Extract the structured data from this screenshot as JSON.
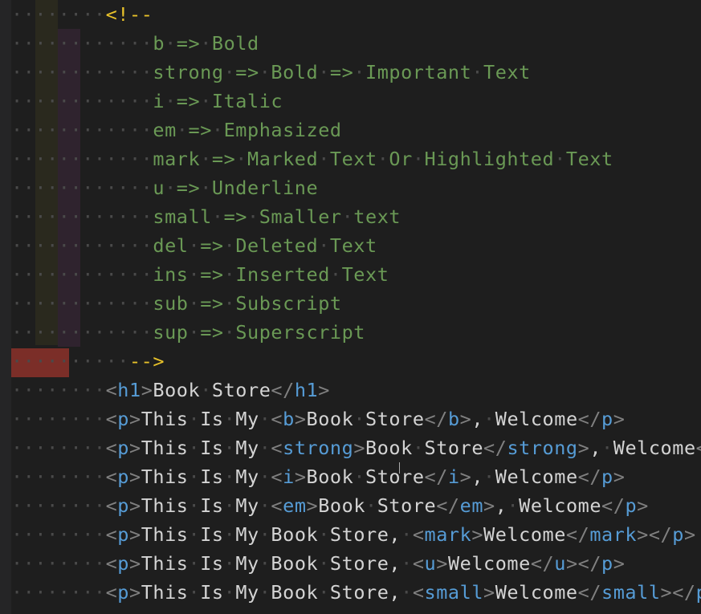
{
  "editor": {
    "comment_open": "<!--",
    "comment_close": "-->",
    "comment_lines": [
      "b => Bold",
      "strong => Bold => Important Text",
      "i => Italic",
      "em => Emphasized",
      "mark => Marked Text Or Highlighted Text",
      "u => Underline",
      "small => Smaller text",
      "del => Deleted Text",
      "ins => Inserted Text",
      "sub => Subscript",
      "sup => Superscript"
    ],
    "code_lines": [
      "<h1>Book Store</h1>",
      "<p>This Is My <b>Book Store</b>, Welcome</p>",
      "<p>This Is My <strong>Book Store</strong>, Welcome</p>",
      "<p>This Is My <i>Book Store</i>, Welcome</p>",
      "<p>This Is My <em>Book Store</em>, Welcome</p>",
      "<p>This Is My Book Store, <mark>Welcome</mark></p>",
      "<p>This Is My Book Store, <u>Welcome</u></p>",
      "<p>This Is My Book Store, <small>Welcome</small></p>"
    ]
  },
  "colors": {
    "background": "#1e1e1e",
    "comment": "#6a9955",
    "comment_delimiter": "#e8c22a",
    "tag_name": "#569cd6",
    "bracket": "#808080",
    "text": "#d4d4d4",
    "error_highlight": "#c83c32"
  }
}
